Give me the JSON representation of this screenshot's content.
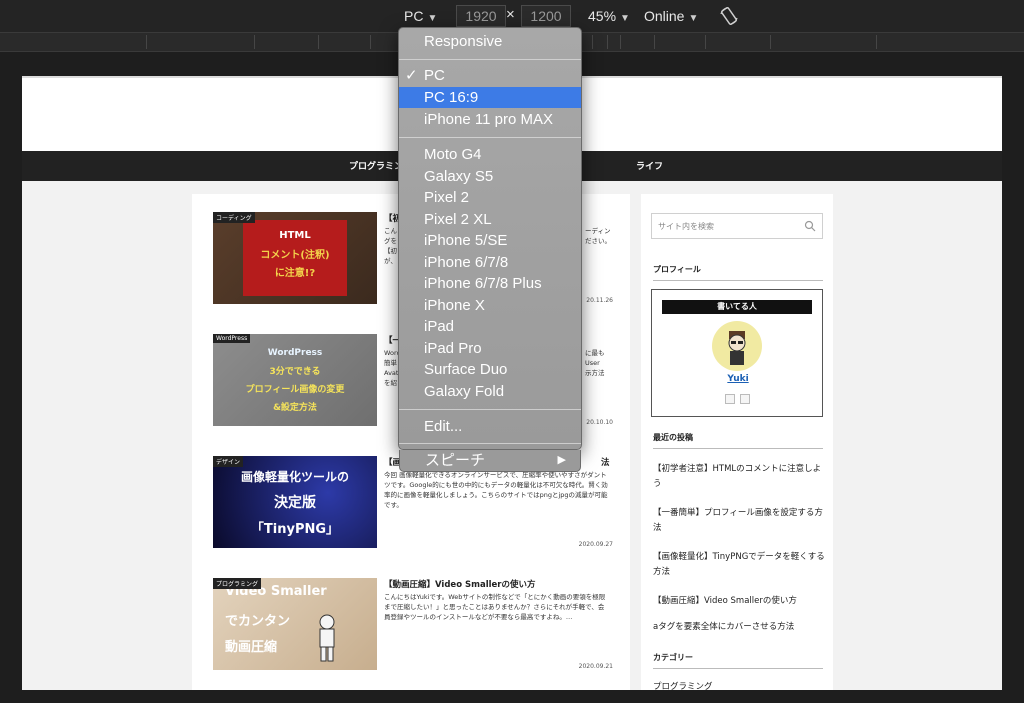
{
  "toolbar": {
    "device": "PC",
    "width": "1920",
    "height": "1200",
    "times": "×",
    "zoom": "45%",
    "network": "Online",
    "caret": "▼"
  },
  "menu": {
    "items": [
      "Responsive",
      "PC",
      "PC 16:9",
      "iPhone 11 pro MAX",
      "Moto G4",
      "Galaxy S5",
      "Pixel 2",
      "Pixel 2 XL",
      "iPhone 5/SE",
      "iPhone 6/7/8",
      "iPhone 6/7/8 Plus",
      "iPhone X",
      "iPad",
      "iPad Pro",
      "Surface Duo",
      "Galaxy Fold",
      "Edit...",
      "スピーチ"
    ],
    "checked": "PC",
    "highlighted": "PC 16:9",
    "check_mark": "✓",
    "submenu_arrow": "▶"
  },
  "site": {
    "nav": [
      "プログラミン",
      "ライフ"
    ],
    "posts": [
      {
        "category": "コーディング",
        "title": "【初",
        "excerpt_left": "こん\nグを\n【初\nが、",
        "excerpt_right": "ーディン\nださい。",
        "date": "20.11.26",
        "thumb_lines": [
          "HTML",
          "コメント(注釈)",
          "に注意!?"
        ]
      },
      {
        "category": "WordPress",
        "title": "【一",
        "excerpt_left": "Word\n簡単\nAvat\nを紹",
        "excerpt_right": "に最も\nUser\n示方法",
        "date": "20.10.10",
        "thumb_lines": [
          "WordPress",
          "3分でできる",
          "プロフィール画像の変更",
          "&設定方法"
        ]
      },
      {
        "category": "デザイン",
        "title": "【画",
        "title_right": "法",
        "excerpt": "今回                                                    画像軽量化できるオンラインサービスで、圧縮率や使いやすさがダントツです。Google的にも世の中的にもデータの軽量化は不可欠な時代。賢く効率的に画像を軽量化しましょう。こちらのサイトではpngとjpgの減量が可能です。",
        "date": "2020.09.27",
        "thumb_lines": [
          "画像軽量化ツールの",
          "決定版",
          "「TinyPNG」"
        ]
      },
      {
        "category": "プログラミング",
        "title": "【動画圧縮】Video Smallerの使い方",
        "excerpt": "こんにちはYukiです。Webサイトの制作などで「とにかく動画の要領を極限まで圧縮したい！」と思ったことはありませんか？さらにそれが手軽で、会員登録やツールのインストールなどが不要なら最高ですよね。…",
        "date": "2020.09.21",
        "thumb_lines": [
          "Video Smaller",
          "でカンタン",
          "動画圧縮"
        ]
      }
    ],
    "sidebar": {
      "search_placeholder": "サイト内を検索",
      "profile_title": "プロフィール",
      "profile_head": "書いてる人",
      "profile_name": "Yuki",
      "recent_title": "最近の投稿",
      "recent": [
        "【初学者注意】HTMLのコメントに注意しよう",
        "【一番簡単】プロフィール画像を設定する方法",
        "【画像軽量化】TinyPNGでデータを軽くする方法",
        "【動画圧縮】Video Smallerの使い方",
        "aタグを要素全体にカバーさせる方法"
      ],
      "category_title": "カテゴリー",
      "category_first": "プログラミング"
    }
  },
  "colors": {
    "toolbar_bg": "#242424",
    "menu_highlight": "#3d7be6",
    "nav_bg": "#222222"
  }
}
